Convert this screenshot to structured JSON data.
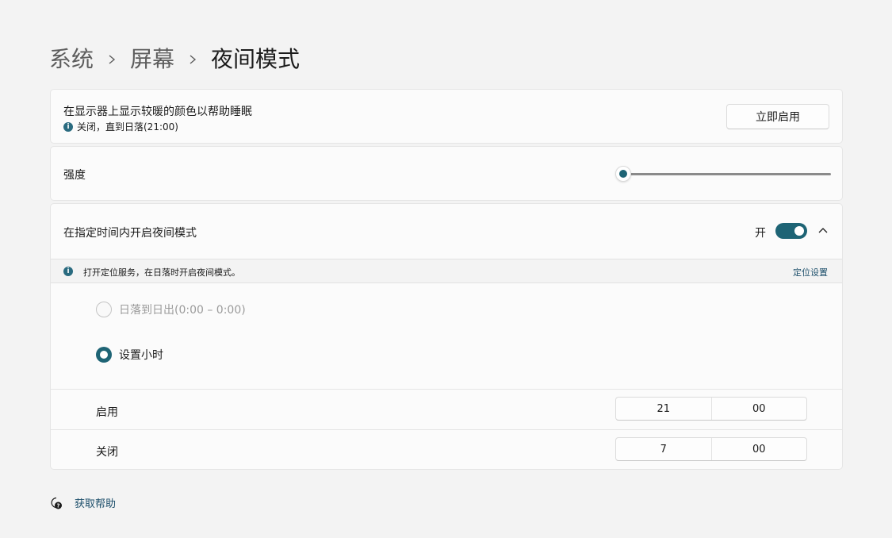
{
  "breadcrumb": {
    "items": [
      "系统",
      "屏幕"
    ],
    "current": "夜间模式"
  },
  "night_light": {
    "title": "在显示器上显示较暖的颜色以帮助睡眠",
    "status": "关闭，直到日落(21:00)",
    "enable_button": "立即启用"
  },
  "strength": {
    "label": "强度",
    "value_fraction": 0.0
  },
  "schedule": {
    "title": "在指定时间内开启夜间模式",
    "toggle_state": "开",
    "info": "打开定位服务，在日落时开启夜间模式。",
    "location_link": "定位设置",
    "options": [
      {
        "label": "日落到日出(0:00 – 0:00)",
        "selected": false,
        "enabled": false
      },
      {
        "label": "设置小时",
        "selected": true,
        "enabled": true
      }
    ],
    "on_time": {
      "label": "启用",
      "hour": "21",
      "minute": "00"
    },
    "off_time": {
      "label": "关闭",
      "hour": "7",
      "minute": "00"
    }
  },
  "help": {
    "label": "获取帮助"
  },
  "colors": {
    "accent": "#1e6475",
    "link": "#1d4f6b",
    "background": "#f3f3f3",
    "card": "#fbfbfb"
  }
}
